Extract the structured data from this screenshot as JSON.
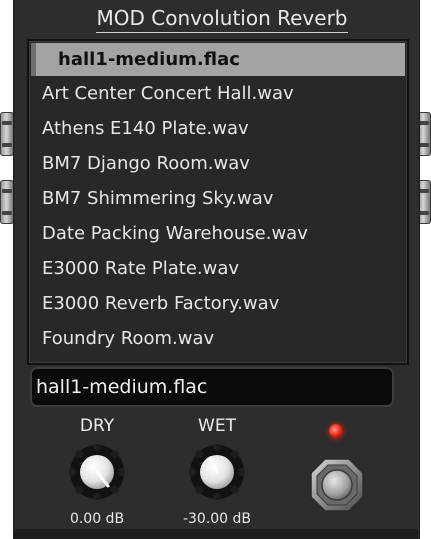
{
  "plugin": {
    "title": "MOD Convolution Reverb"
  },
  "file_list": {
    "items": [
      {
        "label": "hall1-medium.flac",
        "selected": true
      },
      {
        "label": "Art Center Concert Hall.wav",
        "selected": false
      },
      {
        "label": "Athens E140 Plate.wav",
        "selected": false
      },
      {
        "label": "BM7 Django Room.wav",
        "selected": false
      },
      {
        "label": "BM7 Shimmering Sky.wav",
        "selected": false
      },
      {
        "label": "Date Packing Warehouse.wav",
        "selected": false
      },
      {
        "label": "E3000 Rate Plate.wav",
        "selected": false
      },
      {
        "label": "E3000 Reverb Factory.wav",
        "selected": false
      },
      {
        "label": "Foundry Room.wav",
        "selected": false
      }
    ]
  },
  "current_file": {
    "value": "hall1-medium.flac"
  },
  "controls": {
    "dry": {
      "label": "DRY",
      "value": "0.00 dB"
    },
    "wet": {
      "label": "WET",
      "value": "-30.00 dB"
    }
  },
  "led": {
    "state": "on",
    "color": "#e21c10"
  },
  "colors": {
    "panel": "#2d2d2d",
    "selected_row": "#a3a3a3",
    "text": "#e6e6e6"
  },
  "icons": {
    "jack_left_1": "audio-jack-icon",
    "jack_left_2": "audio-jack-icon",
    "jack_right_1": "audio-jack-icon",
    "jack_right_2": "audio-jack-icon",
    "footswitch": "footswitch-icon"
  }
}
